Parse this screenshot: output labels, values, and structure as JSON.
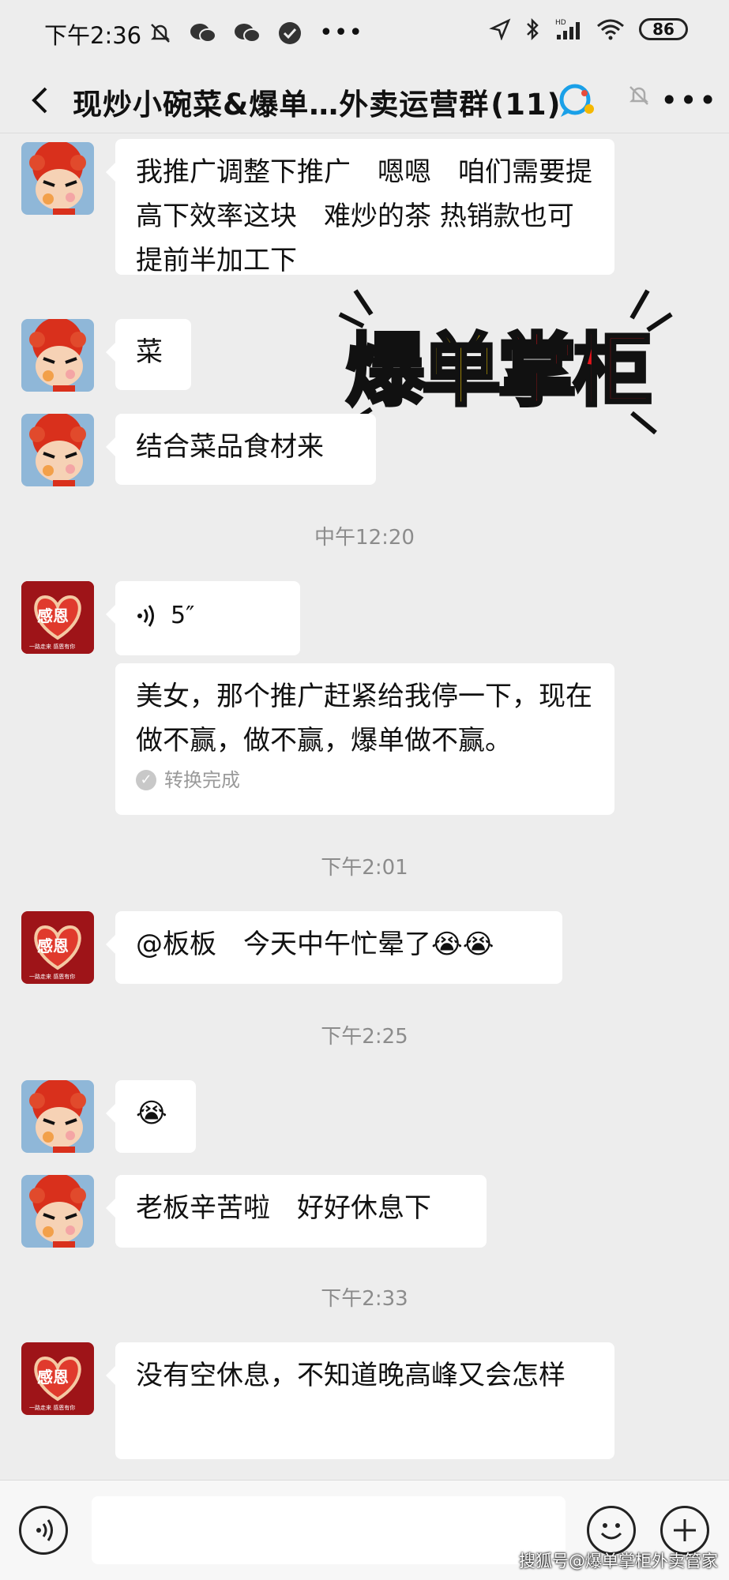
{
  "status_bar": {
    "time": "下午2:36",
    "left_icons": [
      "mute-bell-icon",
      "wechat-icon",
      "wechat-icon",
      "check-circle-icon",
      "more-dots-icon"
    ],
    "right_icons": [
      "location-arrow-icon",
      "bluetooth-icon",
      "signal-hd-icon",
      "wifi-icon"
    ],
    "battery": "86"
  },
  "nav": {
    "title": "现炒小碗菜&爆单…外卖运营群",
    "member_count": "(11)"
  },
  "sticker": {
    "text_red_1": "爆",
    "text_yellow": "单",
    "text_red_2": "掌柜"
  },
  "messages": {
    "m1": "我推广调整下推广　嗯嗯　咱们需要提高下效率这块　难炒的茶 热销款也可提前半加工下",
    "m2": "菜",
    "m3": "结合菜品食材来",
    "ts1": "中午12:20",
    "voice_duration": "5″",
    "m4": "美女，那个推广赶紧给我停一下，现在做不赢，做不赢，爆单做不赢。",
    "m4_status": "转换完成",
    "ts2": "下午2:01",
    "m5": "@板板　今天中午忙晕了😭😭",
    "ts3": "下午2:25",
    "m6": "😭",
    "m7": "老板辛苦啦　好好休息下",
    "ts4": "下午2:33",
    "m8": "没有空休息，不知道晚高峰又会怎样"
  },
  "avatar_labels": {
    "gan_en": "感恩",
    "gan_en_sub": "一路走来 感恩有你"
  },
  "watermark": "搜狐号@爆单掌柜外卖管家"
}
